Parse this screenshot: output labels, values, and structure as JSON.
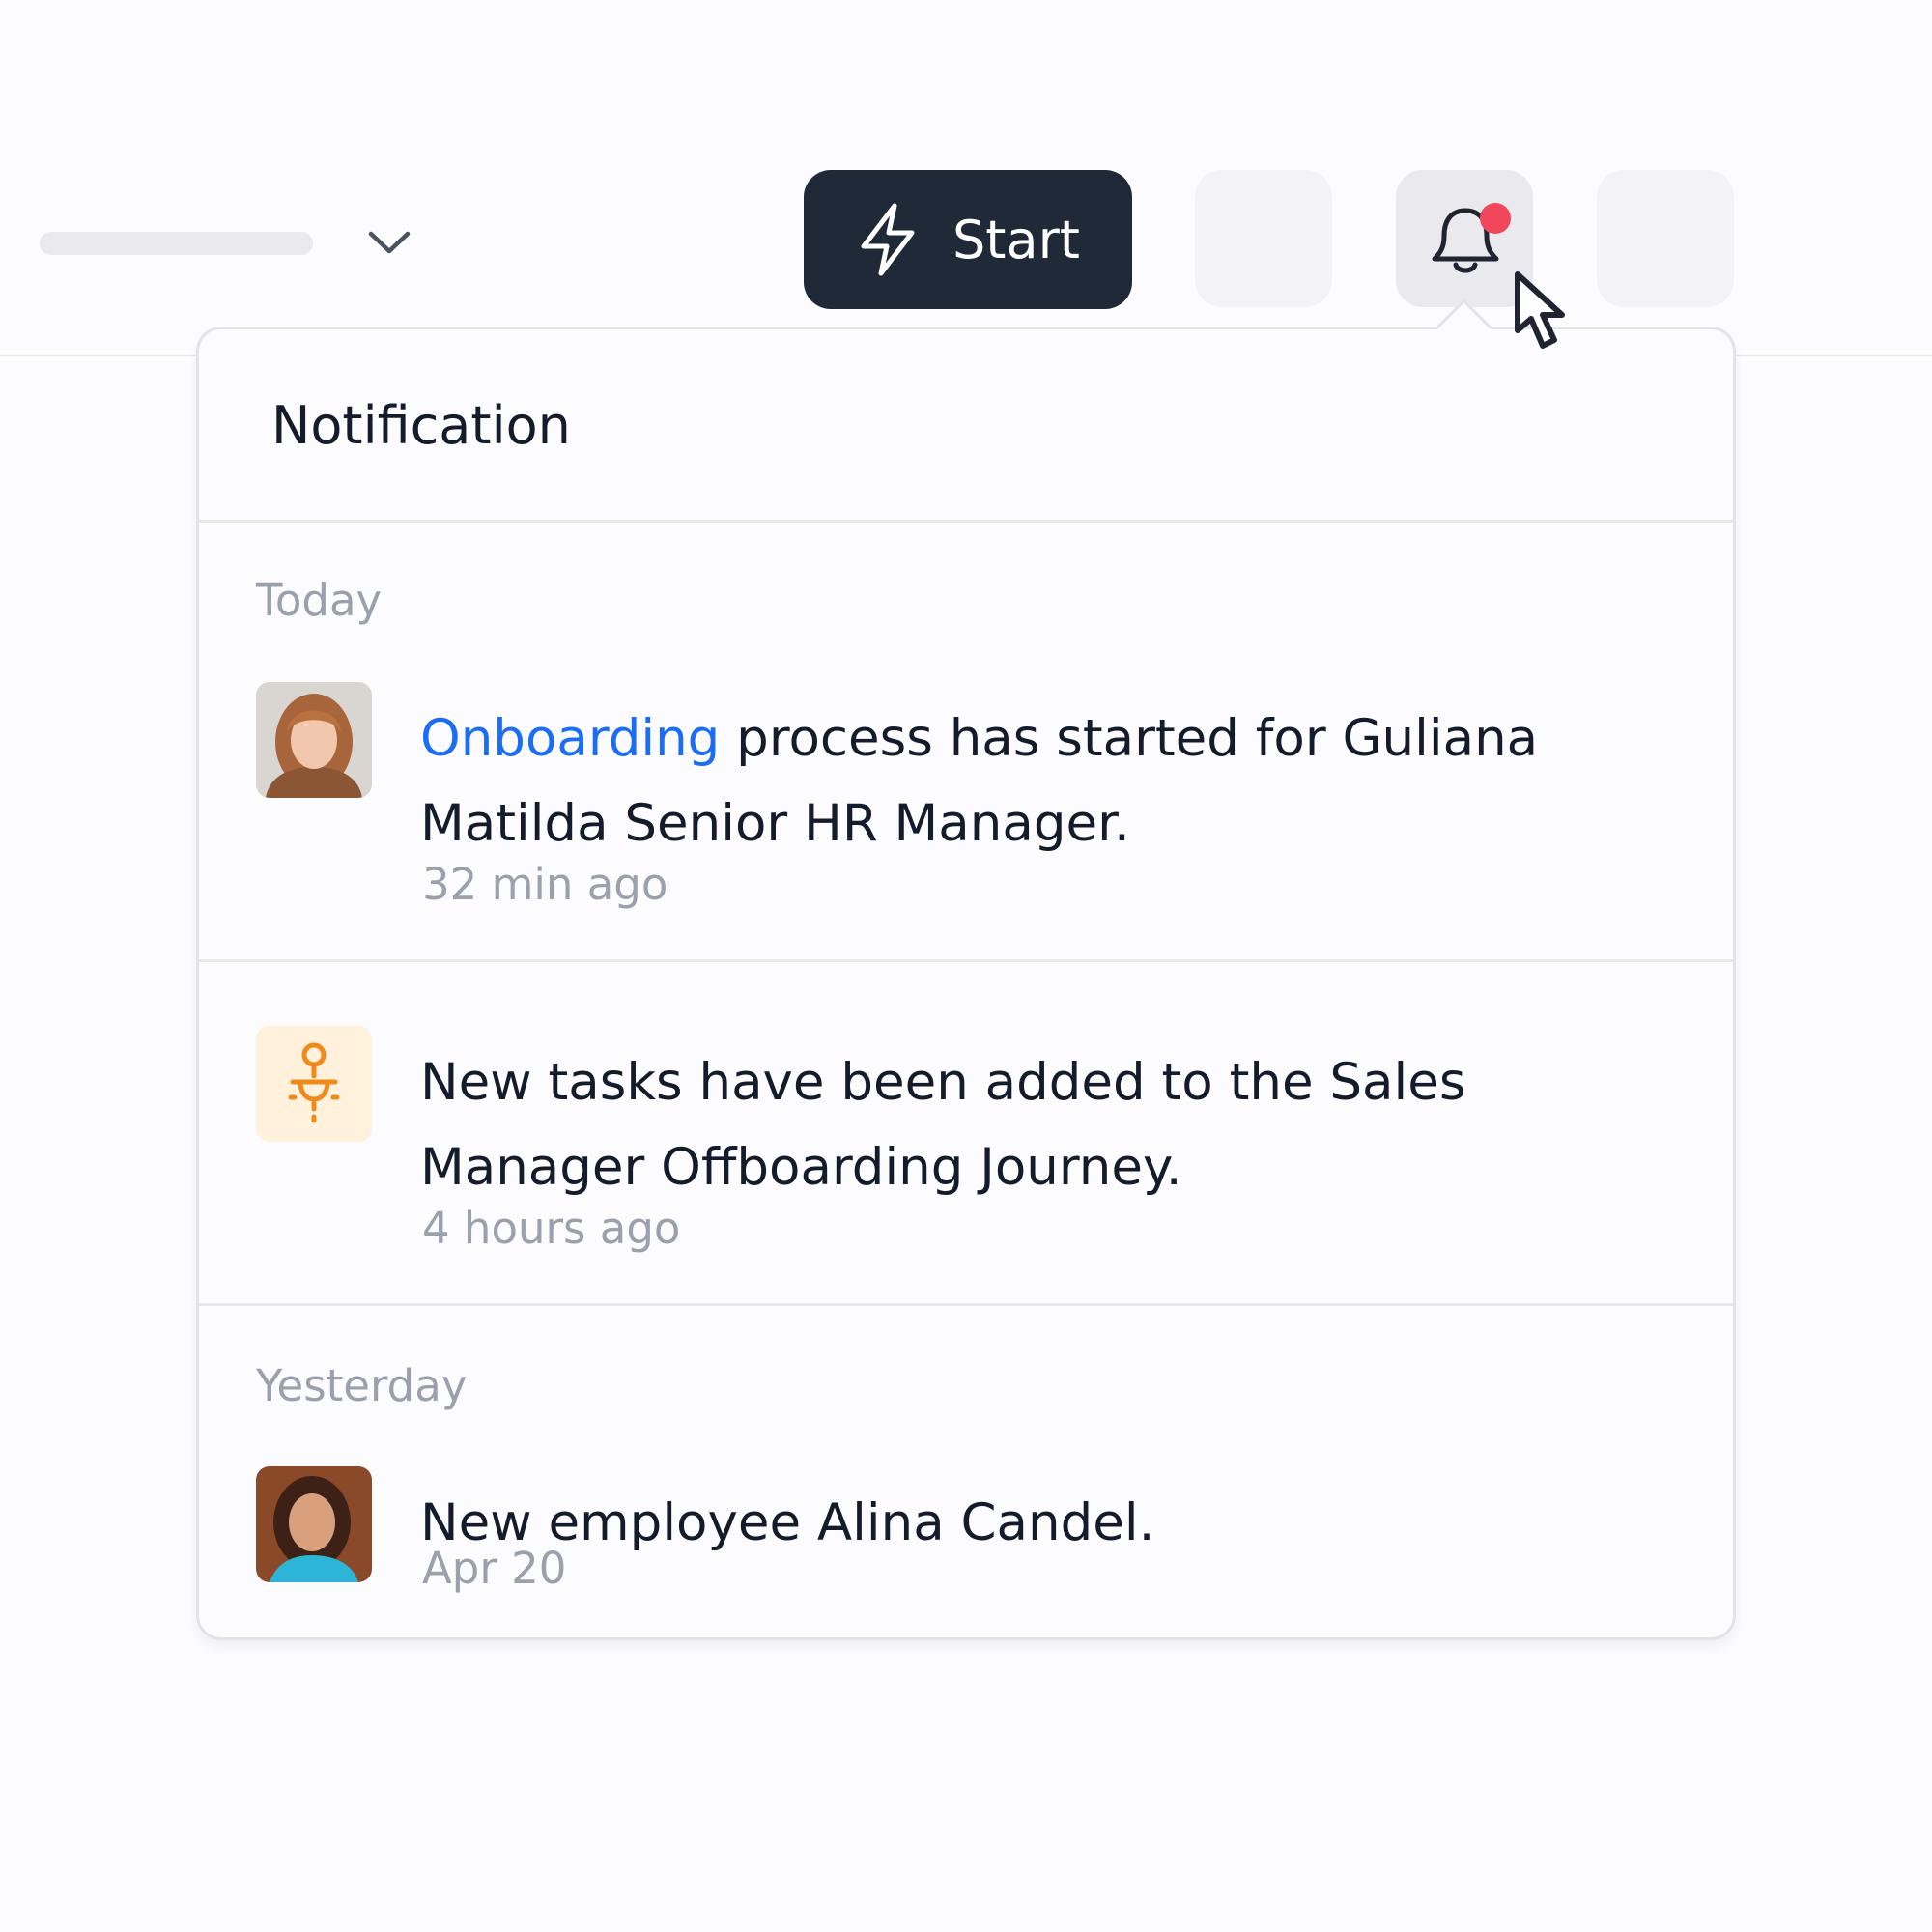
{
  "toolbar": {
    "start_label": "Start",
    "icons": [
      "chevron-down-icon",
      "lightning-icon",
      "bell-icon",
      "cursor-icon"
    ],
    "notification_dot_color": "#f2475b"
  },
  "panel": {
    "title": "Notification",
    "groups": [
      {
        "label": "Today",
        "items": [
          {
            "link_text": "Onboarding",
            "message": " process has started for Guliana Matilda Senior HR Manager.",
            "time": "32 min ago",
            "icon": "avatar-photo"
          },
          {
            "message": "New tasks have been added to the Sales Manager Offboarding Journey.",
            "time": "4 hours ago",
            "icon": "journey-icon"
          }
        ]
      },
      {
        "label": "Yesterday",
        "items": [
          {
            "message": "New employee Alina Candel.",
            "time": "Apr 20",
            "icon": "avatar-photo"
          }
        ]
      }
    ]
  },
  "colors": {
    "accent_link": "#1b6ef3",
    "start_button": "#1f2937",
    "journey_icon": "#f08a1c",
    "journey_icon_bg": "#fff1dc"
  }
}
